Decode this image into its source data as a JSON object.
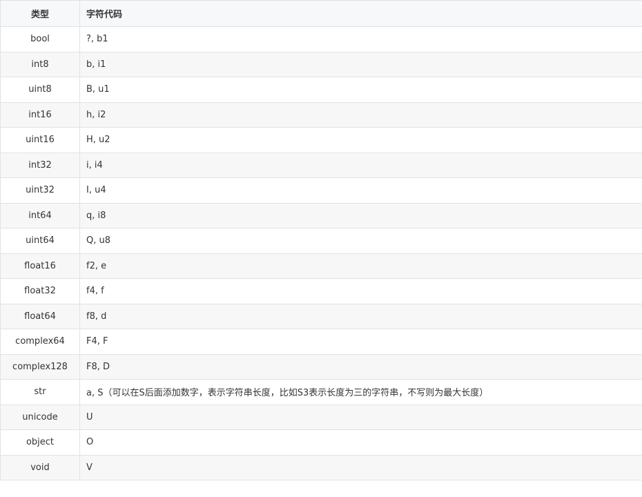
{
  "table": {
    "headers": {
      "type": "类型",
      "code": "字符代码"
    },
    "rows": [
      {
        "type": "bool",
        "code": "?, b1"
      },
      {
        "type": "int8",
        "code": "b, i1"
      },
      {
        "type": "uint8",
        "code": "B, u1"
      },
      {
        "type": "int16",
        "code": "h, i2"
      },
      {
        "type": "uint16",
        "code": "H, u2"
      },
      {
        "type": "int32",
        "code": "i, i4"
      },
      {
        "type": "uint32",
        "code": "I, u4"
      },
      {
        "type": "int64",
        "code": "q, i8"
      },
      {
        "type": "uint64",
        "code": "Q, u8"
      },
      {
        "type": "float16",
        "code": "f2, e"
      },
      {
        "type": "float32",
        "code": "f4, f"
      },
      {
        "type": "float64",
        "code": "f8, d"
      },
      {
        "type": "complex64",
        "code": "F4, F"
      },
      {
        "type": "complex128",
        "code": "F8, D"
      },
      {
        "type": "str",
        "code": "a, S（可以在S后面添加数字，表示字符串长度，比如S3表示长度为三的字符串，不写则为最大长度）"
      },
      {
        "type": "unicode",
        "code": "U"
      },
      {
        "type": "object",
        "code": "O"
      },
      {
        "type": "void",
        "code": "V"
      }
    ]
  },
  "colors": {
    "header_bg": "#f6f8fa",
    "stripe_bg": "#f7f7f7",
    "border": "#dfe2e5",
    "text": "#333333"
  }
}
